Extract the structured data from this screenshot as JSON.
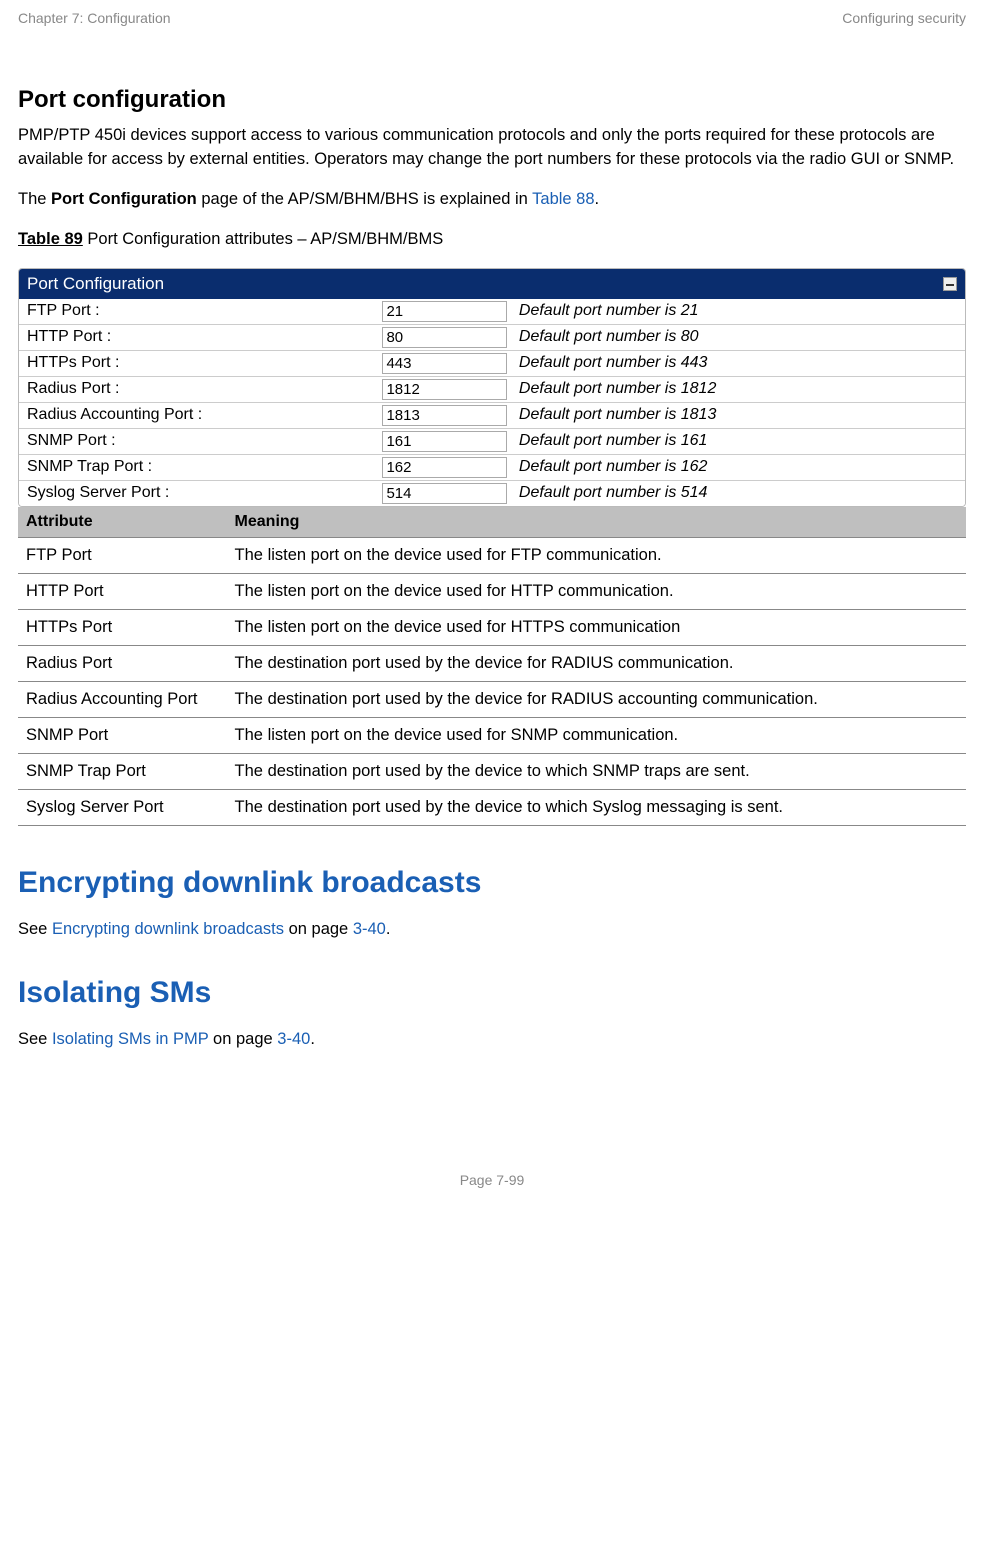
{
  "header": {
    "left": "Chapter 7:  Configuration",
    "right": "Configuring security"
  },
  "section1": {
    "title": "Port configuration",
    "para1": "PMP/PTP 450i devices support access to various communication protocols and only the ports required for these protocols are available for access by external entities. Operators may change the port numbers for these protocols via the radio GUI or SNMP.",
    "para2_pre": "The ",
    "para2_bold": "Port Configuration",
    "para2_mid": " page of the AP/SM/BHM/BHS is explained in ",
    "para2_link": "Table 88",
    "para2_post": ".",
    "table_caption_bold": "Table 89",
    "table_caption_rest": "  Port Configuration attributes – AP/SM/BHM/BMS"
  },
  "portConfig": {
    "title": "Port Configuration",
    "rows": [
      {
        "label": "FTP Port :",
        "value": "21",
        "note": "Default port number is 21"
      },
      {
        "label": "HTTP Port :",
        "value": "80",
        "note": "Default port number is 80"
      },
      {
        "label": "HTTPs Port :",
        "value": "443",
        "note": "Default port number is 443"
      },
      {
        "label": "Radius Port :",
        "value": "1812",
        "note": "Default port number is 1812"
      },
      {
        "label": "Radius Accounting Port :",
        "value": "1813",
        "note": "Default port number is 1813"
      },
      {
        "label": "SNMP Port :",
        "value": "161",
        "note": "Default port number is 161"
      },
      {
        "label": "SNMP Trap Port :",
        "value": "162",
        "note": "Default port number is 162"
      },
      {
        "label": "Syslog Server Port :",
        "value": "514",
        "note": "Default port number is 514"
      }
    ]
  },
  "attrTable": {
    "head_attr": "Attribute",
    "head_meaning": "Meaning",
    "rows": [
      {
        "attr": "FTP Port",
        "meaning": "The listen port on the device used for FTP communication."
      },
      {
        "attr": "HTTP Port",
        "meaning": "The listen port on the device used for HTTP communication."
      },
      {
        "attr": "HTTPs Port",
        "meaning": "The listen port on the device used for HTTPS communication"
      },
      {
        "attr": "Radius Port",
        "meaning": "The destination port used by the device for RADIUS communication."
      },
      {
        "attr": "Radius Accounting Port",
        "meaning": "The destination port used by the device for RADIUS accounting communication."
      },
      {
        "attr": "SNMP Port",
        "meaning": "The listen port on the device used for SNMP communication."
      },
      {
        "attr": "SNMP Trap Port",
        "meaning": "The destination port used by the device to which SNMP traps are sent."
      },
      {
        "attr": "Syslog Server Port",
        "meaning": "The destination port used by the device to which Syslog messaging is sent."
      }
    ]
  },
  "section2": {
    "title": "Encrypting downlink broadcasts",
    "pre": "See ",
    "link": "Encrypting downlink broadcasts",
    "mid": " on page ",
    "page": "3-40",
    "post": "."
  },
  "section3": {
    "title": "Isolating SMs",
    "pre": "See ",
    "link": "Isolating SMs in PMP",
    "mid": " on page ",
    "page": "3-40",
    "post": "."
  },
  "footer": "Page 7-99"
}
